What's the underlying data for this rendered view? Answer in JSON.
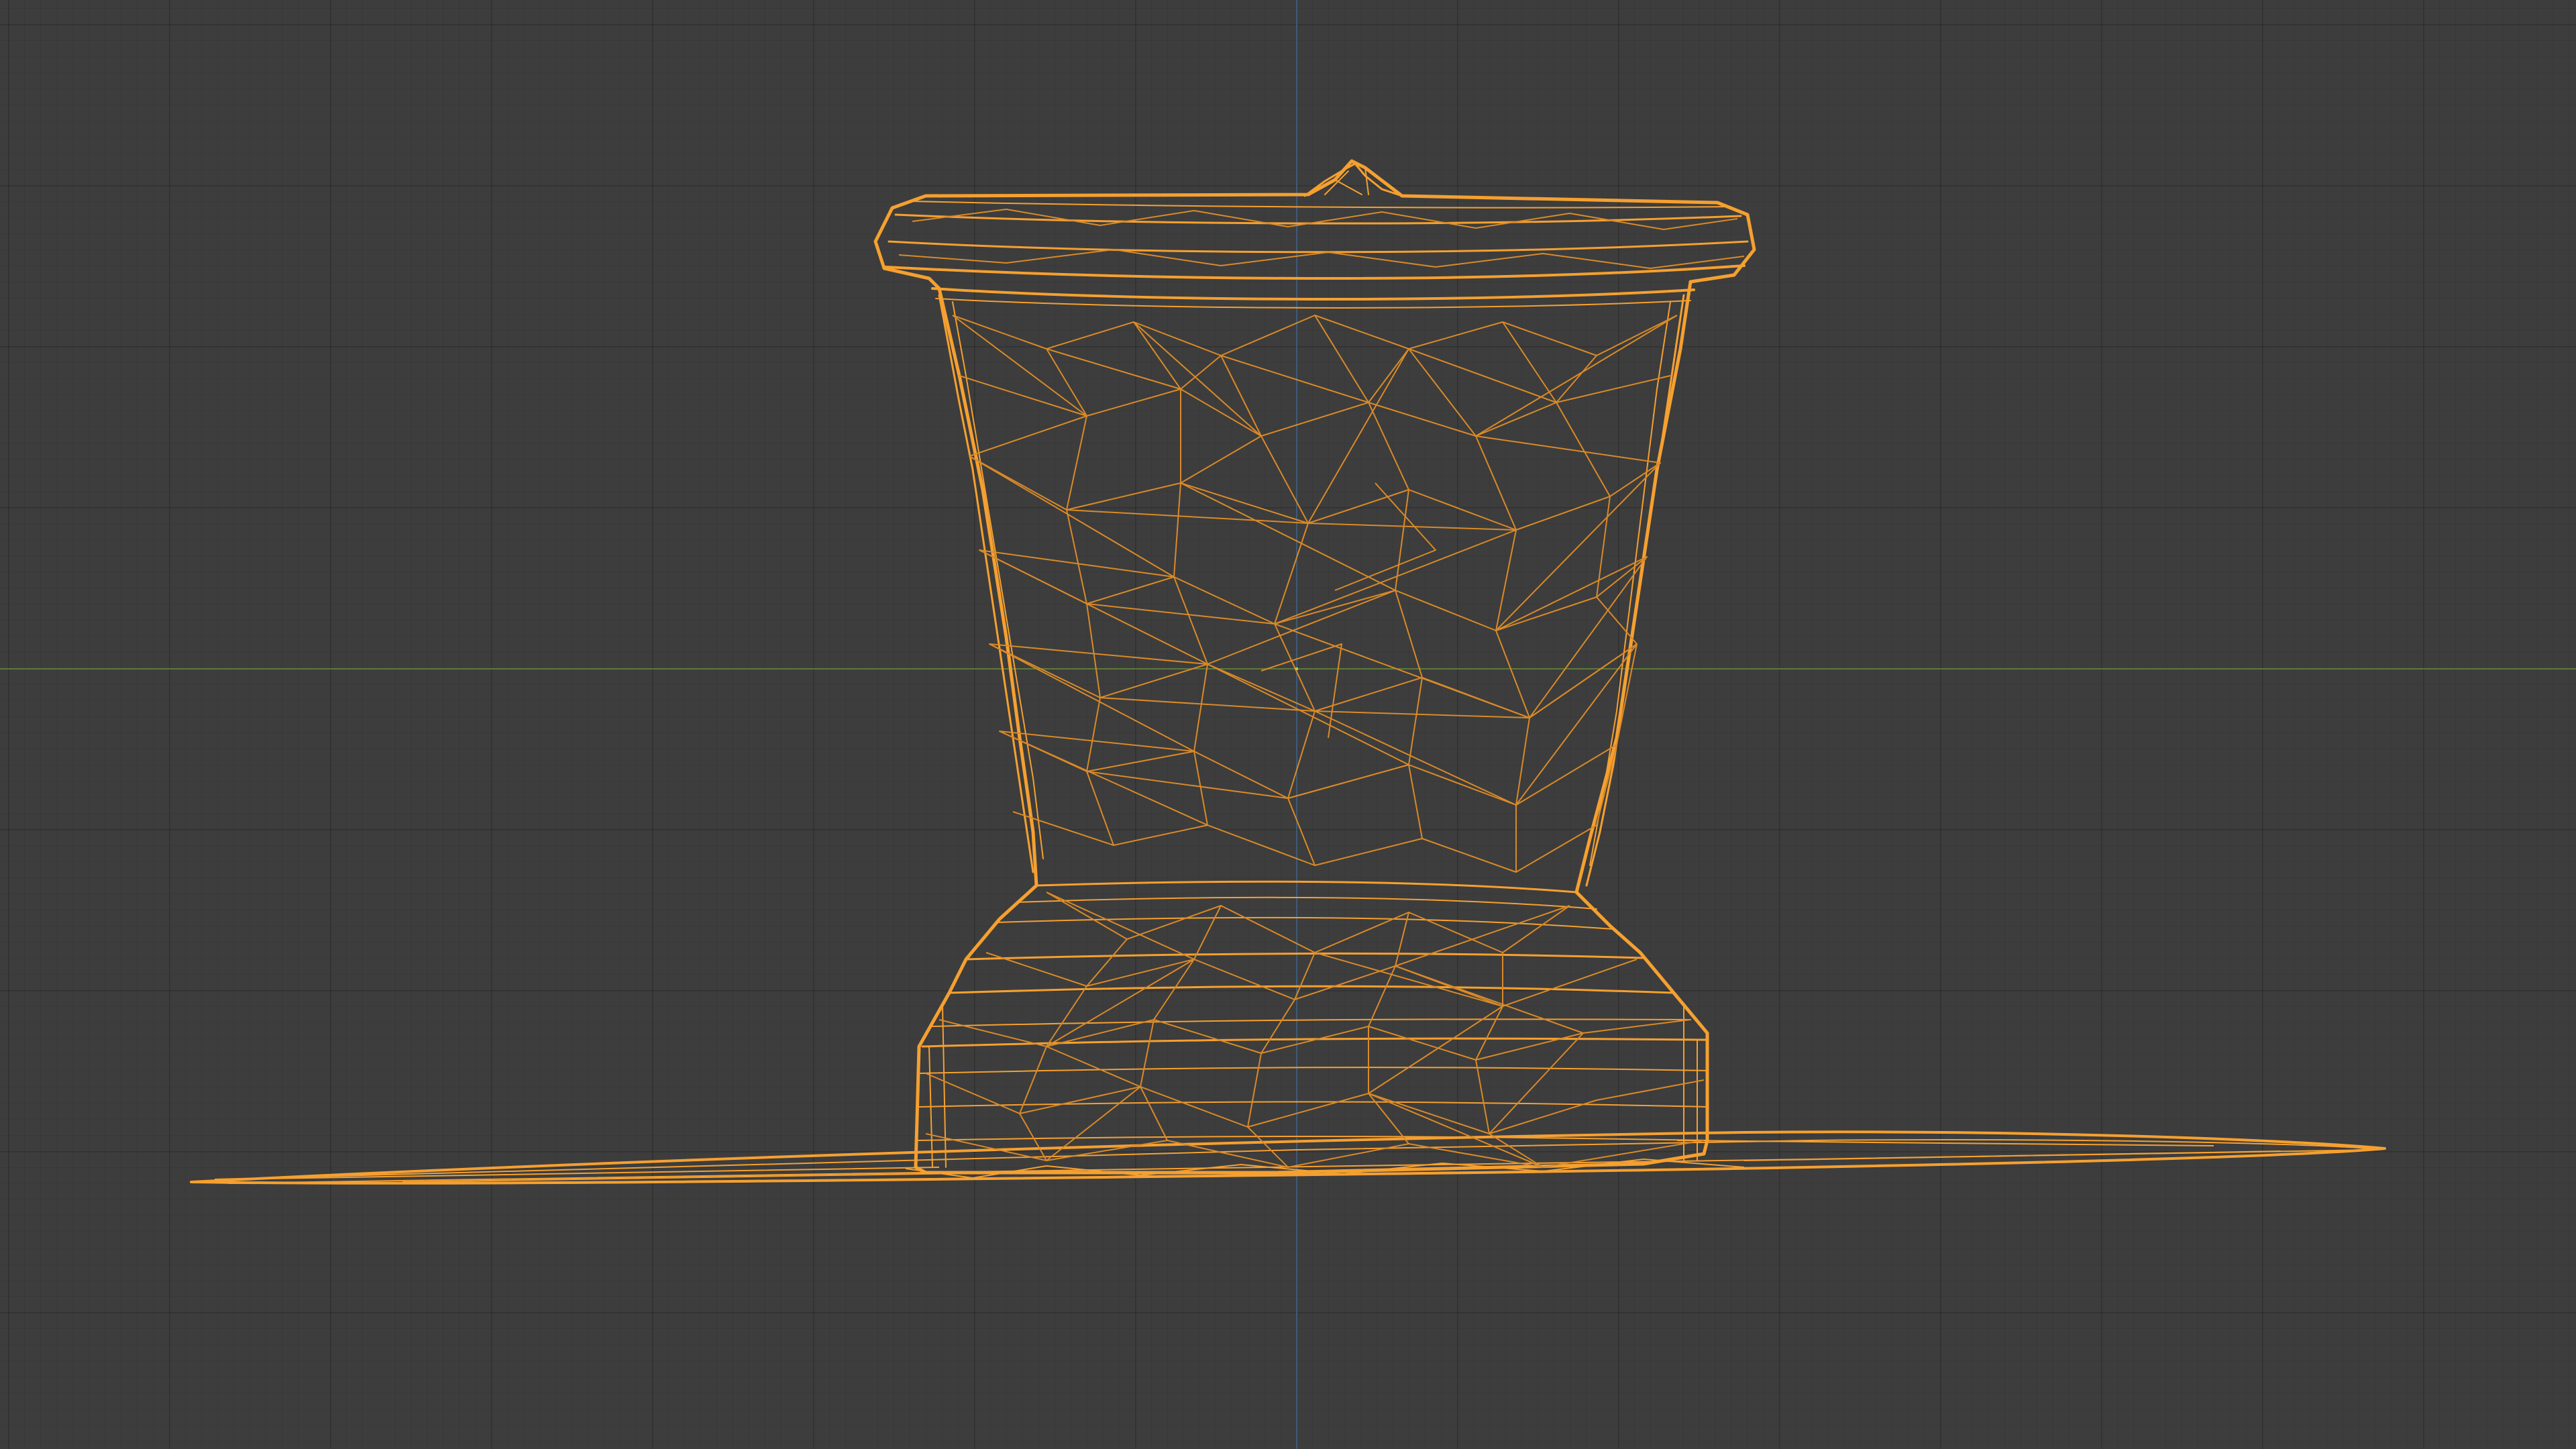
{
  "viewport": {
    "background_color": "#3d3d3d",
    "x_axis_color": "#5d7a3a",
    "z_axis_color": "#3e5a78",
    "selection_wire_color": "#f5a030",
    "origin_color": "#b8c44a"
  },
  "object": {
    "icon": "wireframe-mesh",
    "description_name": "vase-mesh"
  }
}
